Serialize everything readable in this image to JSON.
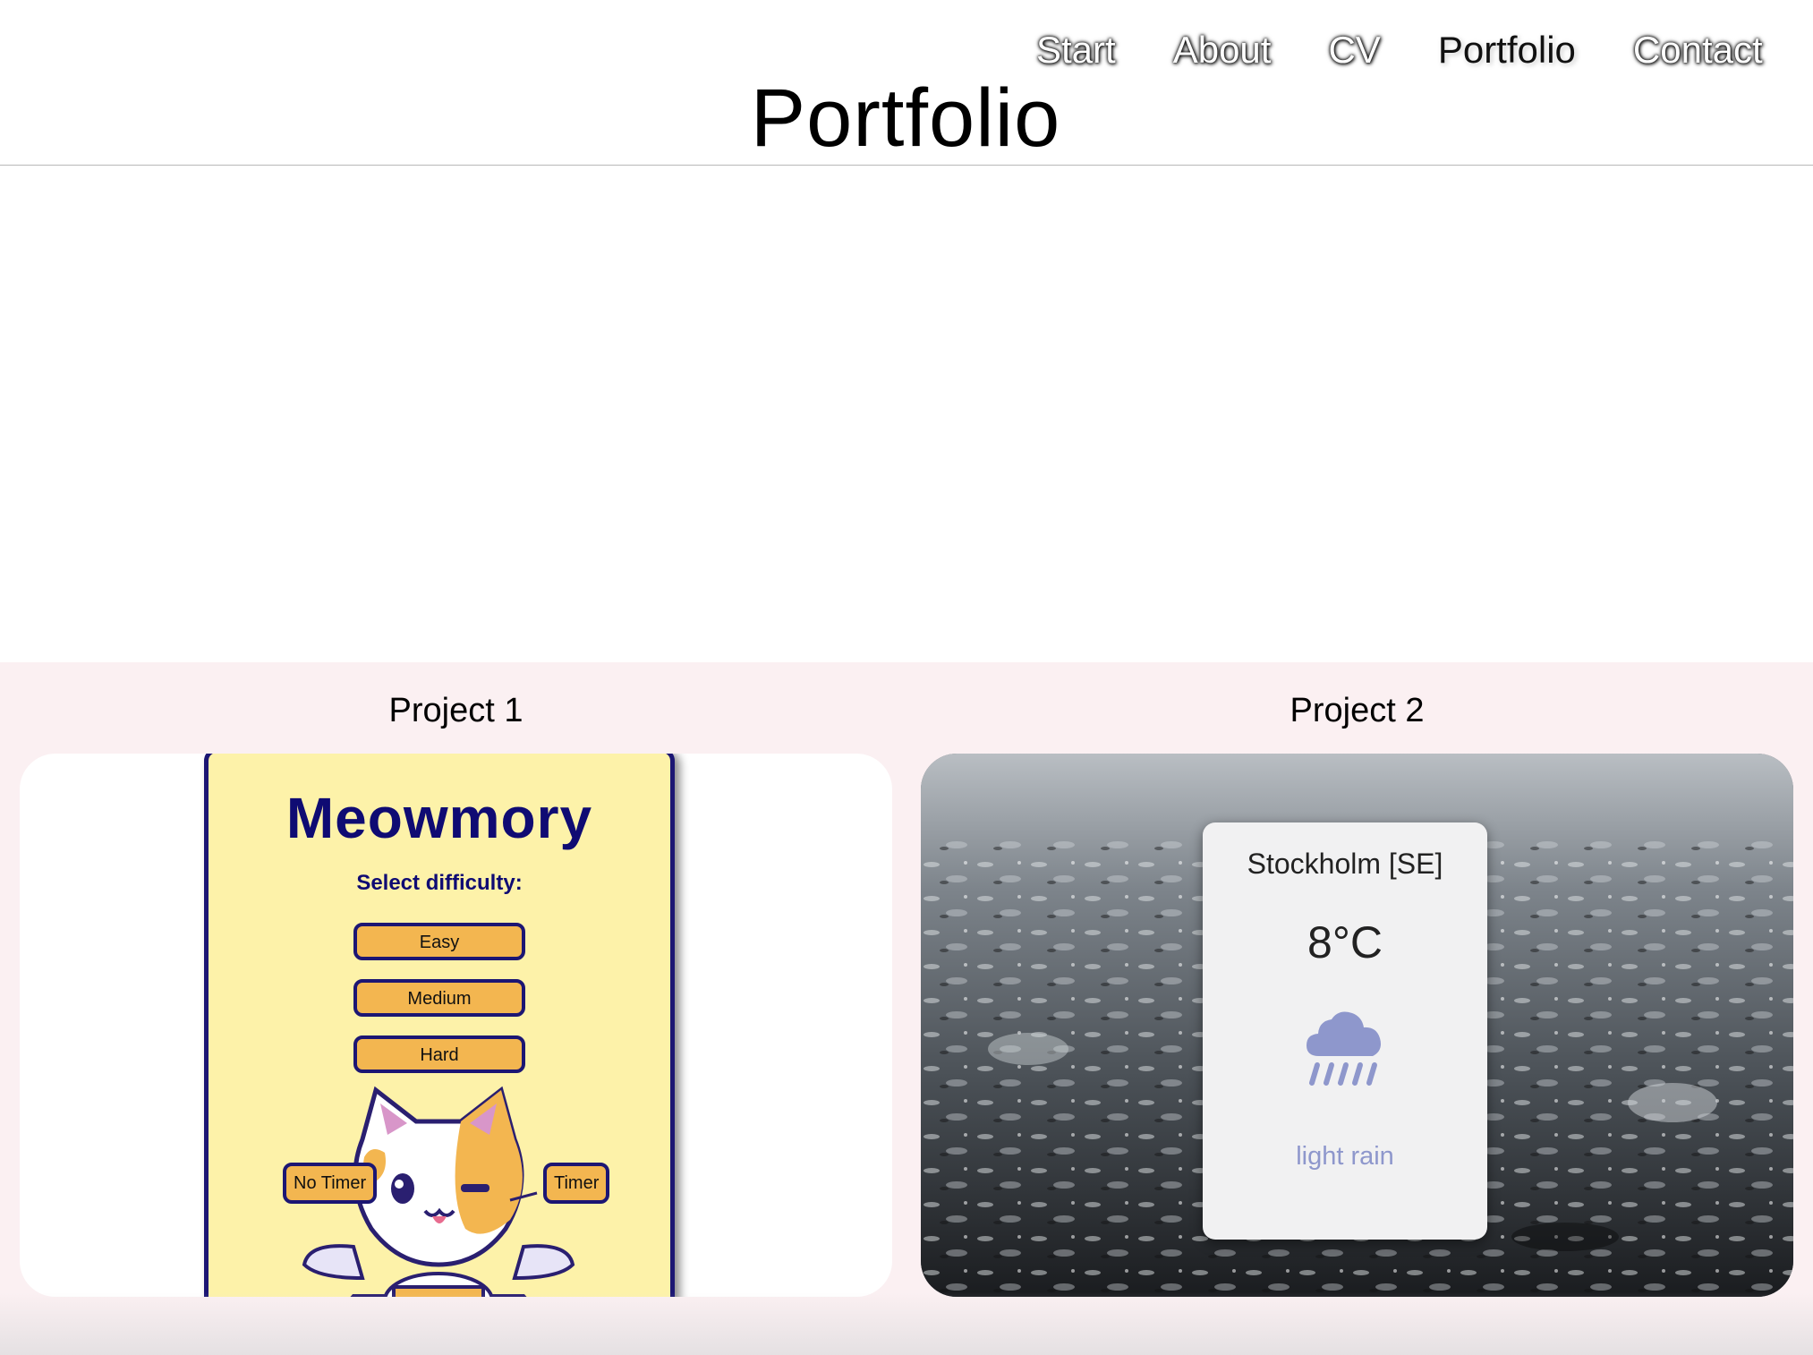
{
  "header": {
    "title": "Portfolio",
    "nav": [
      {
        "label": "Start",
        "active": false
      },
      {
        "label": "About",
        "active": false
      },
      {
        "label": "CV",
        "active": false
      },
      {
        "label": "Portfolio",
        "active": true
      },
      {
        "label": "Contact",
        "active": false
      }
    ]
  },
  "projects": [
    {
      "label": "Project 1",
      "preview": {
        "title": "Meowmory",
        "subtitle": "Select difficulty:",
        "difficulty_buttons": [
          "Easy",
          "Medium",
          "Hard"
        ],
        "timer_buttons": [
          "No Timer",
          "Timer"
        ],
        "colors": {
          "panel": "#fdf2a9",
          "border": "#1c1673",
          "button": "#f3b650"
        }
      }
    },
    {
      "label": "Project 2",
      "preview": {
        "city": "Stockholm [SE]",
        "temperature": "8°C",
        "icon": "rain-cloud-icon",
        "description": "light rain",
        "colors": {
          "card": "#f1f1f2",
          "icon": "#8e97cc"
        }
      }
    }
  ],
  "colors": {
    "section_background": "#fbf0f2",
    "header_rule": "#b8b8b8"
  }
}
